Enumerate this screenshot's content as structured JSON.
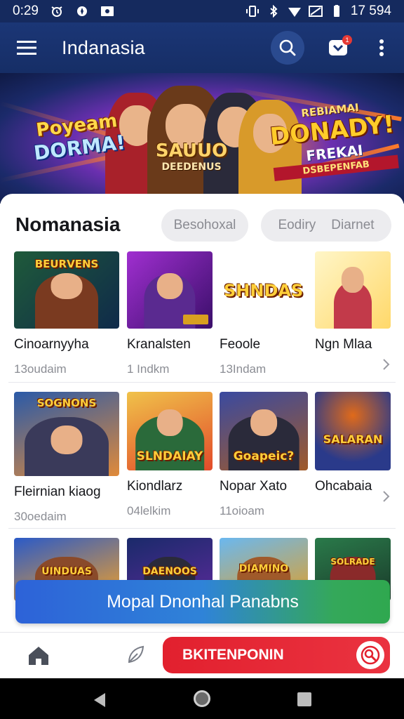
{
  "status_bar": {
    "time": "0:29",
    "right_text": "17 594"
  },
  "app_bar": {
    "title": "Indanasia",
    "notification_badge": "1"
  },
  "banner": {
    "left_line1": "Poyeam",
    "left_line2": "DORMA!",
    "center_line1": "SAUUO",
    "center_line2": "DEEDENUS",
    "right_line1": "REBIAMAI",
    "right_line2": "DONADY!",
    "right_line3": "FREKAI",
    "right_line4": "DSBEPENFAB"
  },
  "section": {
    "title": "Nomanasia",
    "chip1": "Besohoxal",
    "chip2a": "Eodiry",
    "chip2b": "Diarnet"
  },
  "rows": [
    {
      "games": [
        {
          "name": "Cinoarnyyha",
          "sub": "13oudaim",
          "label": "BEURVENS",
          "bg1": "#1f5a3a",
          "bg2": "#0f2a4a",
          "fig": "#7a3a20"
        },
        {
          "name": "Kranalsten",
          "sub": "1 Indkm",
          "label": "",
          "bg1": "#8a1fb0",
          "bg2": "#3a0f6a",
          "fig": "#5a2a90"
        },
        {
          "name": "Feoole",
          "sub": "13Indam",
          "label": "SHNDAS",
          "bg1": "#ffffff",
          "bg2": "#f2f2f2",
          "fig": ""
        },
        {
          "name": "Ngn Mlaa",
          "sub": "",
          "label": "",
          "bg1": "#fff6c8",
          "bg2": "#ffd86a",
          "fig": "#c23a4a"
        }
      ]
    },
    {
      "games": [
        {
          "name": "Fleirnian kiaog",
          "sub": "30oedaim",
          "label": "SOGNONS",
          "bg1": "#2a5aa8",
          "bg2": "#e08a3a",
          "fig": "#3a3a5a"
        },
        {
          "name": "Kiondlarz",
          "sub": "04lelkim",
          "label": "SLNDAIAY",
          "bg1": "#f0c24a",
          "bg2": "#e24a2a",
          "fig": "#2a6a3a"
        },
        {
          "name": "Nopar Xato",
          "sub": "11oioam",
          "label": "Goapeic?",
          "bg1": "#3a4aa0",
          "bg2": "#a05a2a",
          "fig": "#2a2a3a"
        },
        {
          "name": "Ohcabaia",
          "sub": "",
          "label": "SALARAN",
          "bg1": "#2a3a8a",
          "bg2": "#e06a1a",
          "fig": ""
        }
      ]
    },
    {
      "games": [
        {
          "name": "",
          "sub": "",
          "label": "UINDUAS",
          "bg1": "#2a5ac8",
          "bg2": "#f0a02a",
          "fig": "#8a4a2a"
        },
        {
          "name": "",
          "sub": "",
          "label": "DAENOOS",
          "bg1": "#1a2a6a",
          "bg2": "#5a2a9a",
          "fig": "#2a2a3a"
        },
        {
          "name": "",
          "sub": "",
          "label": "DIAMINO",
          "bg1": "#6ab8f0",
          "bg2": "#e0a02a",
          "fig": "#a05a2a"
        },
        {
          "name": "",
          "sub": "",
          "label": "SOLRADE",
          "bg1": "#2a7a4a",
          "bg2": "#1a3a2a",
          "fig": "#8a2a2a"
        }
      ]
    }
  ],
  "cta": {
    "label": "Mopal Dnonhal Panabns"
  },
  "bottom_bar": {
    "pill_label": "BKITENPONIN"
  },
  "colors": {
    "app_bar": "#1b3676",
    "cta_start": "#2d62d8",
    "cta_end": "#2fa84f",
    "red_pill": "#e2202e"
  }
}
